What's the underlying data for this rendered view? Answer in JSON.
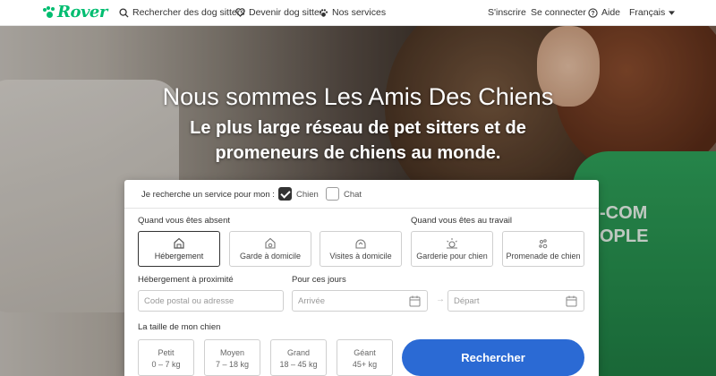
{
  "brand": {
    "name": "Rover",
    "color": "#00bd70"
  },
  "nav": {
    "left": [
      {
        "label": "Rechercher des dog sitters",
        "icon": "search-icon"
      },
      {
        "label": "Devenir dog sitter",
        "icon": "heart-icon"
      },
      {
        "label": "Nos services",
        "icon": "paw-icon"
      }
    ],
    "signup": "S'inscrire",
    "login": "Se connecter",
    "help": "Aide",
    "help_icon": "question-circle-icon",
    "language": "Français"
  },
  "hero": {
    "title": "Nous sommes Les Amis Des Chiens",
    "subtitle_line1": "Le plus large réseau de pet sitters et de",
    "subtitle_line2": "promeneurs de chiens au monde."
  },
  "search": {
    "pet_prompt": "Je recherche un service pour mon :",
    "pets": [
      {
        "label": "Chien",
        "checked": true
      },
      {
        "label": "Chat",
        "checked": false
      }
    ],
    "away_label": "Quand vous êtes absent",
    "work_label": "Quand vous êtes au travail",
    "services": [
      {
        "label": "Hébergement",
        "icon": "house-icon",
        "selected": true
      },
      {
        "label": "Garde à domicile",
        "icon": "home-sitting-icon",
        "selected": false
      },
      {
        "label": "Visites à domicile",
        "icon": "drop-in-icon",
        "selected": false
      },
      {
        "label": "Garderie pour chien",
        "icon": "sun-icon",
        "selected": false
      },
      {
        "label": "Promenade de chien",
        "icon": "paw-walk-icon",
        "selected": false
      }
    ],
    "nearby_label": "Hébergement à proximité",
    "zip_placeholder": "Code postal ou adresse",
    "dates_label": "Pour ces jours",
    "arrival_placeholder": "Arrivée",
    "departure_placeholder": "Départ",
    "size_label": "La taille de mon chien",
    "sizes": [
      {
        "name": "Petit",
        "range": "0 – 7 kg"
      },
      {
        "name": "Moyen",
        "range": "7 – 18 kg"
      },
      {
        "name": "Grand",
        "range": "18 – 45 kg"
      },
      {
        "name": "Géant",
        "range": "45+ kg"
      }
    ],
    "submit": "Rechercher",
    "accent": "#2b6ad4"
  },
  "photo": {
    "shirt_text_line1": "-COM",
    "shirt_text_line2": "OPLE"
  }
}
